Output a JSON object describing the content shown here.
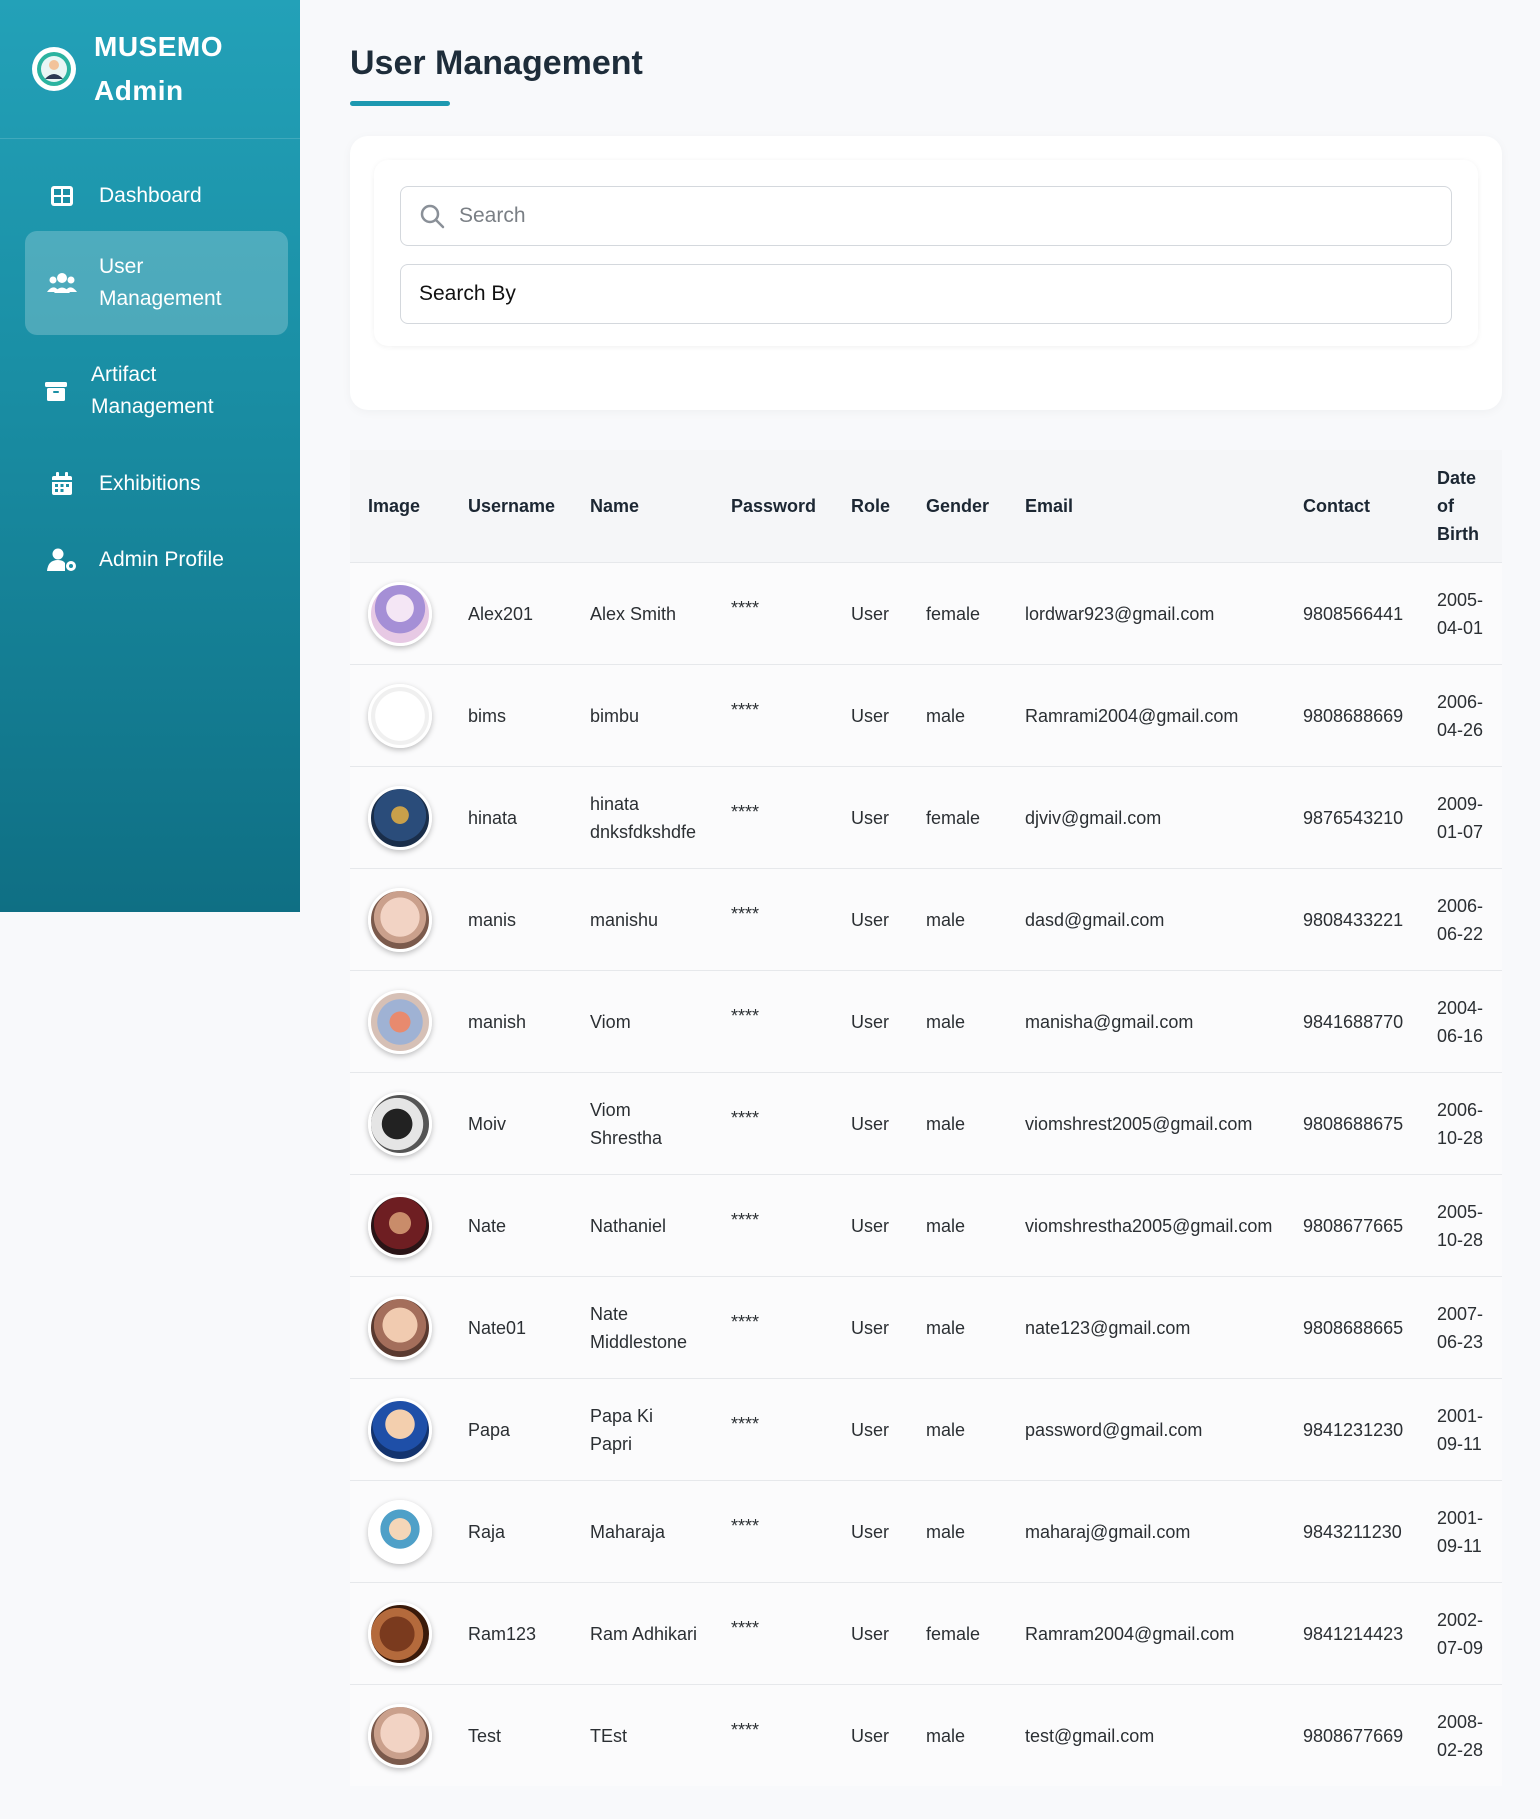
{
  "brand": {
    "line1": "MUSEMO",
    "line2": "Admin"
  },
  "nav": [
    {
      "label": "Dashboard",
      "icon": "dashboard-grid-icon"
    },
    {
      "label": "User Management",
      "icon": "users-icon",
      "active": true
    },
    {
      "label": "Artifact Management",
      "icon": "archive-box-icon"
    },
    {
      "label": "Exhibitions",
      "icon": "calendar-icon"
    },
    {
      "label": "Admin Profile",
      "icon": "user-gear-icon"
    }
  ],
  "page": {
    "title": "User Management"
  },
  "search": {
    "placeholder": "Search",
    "search_by": "Search By"
  },
  "table": {
    "headers": [
      "Image",
      "Username",
      "Name",
      "Password",
      "Role",
      "Gender",
      "Email",
      "Contact",
      "Date of Birth"
    ],
    "rows": [
      {
        "username": "Alex201",
        "name": "Alex Smith",
        "password": "****",
        "role": "User",
        "gender": "female",
        "email": "lordwar923@gmail.com",
        "contact": "9808566441",
        "dob": "2005-04-01"
      },
      {
        "username": "bims",
        "name": "bimbu",
        "password": "****",
        "role": "User",
        "gender": "male",
        "email": "Ramrami2004@gmail.com",
        "contact": "9808688669",
        "dob": "2006-04-26"
      },
      {
        "username": "hinata",
        "name": "hinata dnksfdkshdfe",
        "password": "****",
        "role": "User",
        "gender": "female",
        "email": "djviv@gmail.com",
        "contact": "9876543210",
        "dob": "2009-01-07"
      },
      {
        "username": "manis",
        "name": "manishu",
        "password": "****",
        "role": "User",
        "gender": "male",
        "email": "dasd@gmail.com",
        "contact": "9808433221",
        "dob": "2006-06-22"
      },
      {
        "username": "manish",
        "name": "Viom",
        "password": "****",
        "role": "User",
        "gender": "male",
        "email": "manisha@gmail.com",
        "contact": "9841688770",
        "dob": "2004-06-16"
      },
      {
        "username": "Moiv",
        "name": "Viom Shrestha",
        "password": "****",
        "role": "User",
        "gender": "male",
        "email": "viomshrest2005@gmail.com",
        "contact": "9808688675",
        "dob": "2006-10-28"
      },
      {
        "username": "Nate",
        "name": "Nathaniel",
        "password": "****",
        "role": "User",
        "gender": "male",
        "email": "viomshrestha2005@gmail.com",
        "contact": "9808677665",
        "dob": "2005-10-28"
      },
      {
        "username": "Nate01",
        "name": "Nate Middlestone",
        "password": "****",
        "role": "User",
        "gender": "male",
        "email": "nate123@gmail.com",
        "contact": "9808688665",
        "dob": "2007-06-23"
      },
      {
        "username": "Papa",
        "name": "Papa Ki Papri",
        "password": "****",
        "role": "User",
        "gender": "male",
        "email": "password@gmail.com",
        "contact": "9841231230",
        "dob": "2001-09-11"
      },
      {
        "username": "Raja",
        "name": "Maharaja",
        "password": "****",
        "role": "User",
        "gender": "male",
        "email": "maharaj@gmail.com",
        "contact": "9843211230",
        "dob": "2001-09-11"
      },
      {
        "username": "Ram123",
        "name": "Ram Adhikari",
        "password": "****",
        "role": "User",
        "gender": "female",
        "email": "Ramram2004@gmail.com",
        "contact": "9841214423",
        "dob": "2002-07-09"
      },
      {
        "username": "Test",
        "name": "TEst",
        "password": "****",
        "role": "User",
        "gender": "male",
        "email": "test@gmail.com",
        "contact": "9808677669",
        "dob": "2008-02-28"
      }
    ]
  },
  "colors": {
    "accent": "#1d99b1",
    "sidebar_top": "#23a1b8",
    "sidebar_bottom": "#0f6f84"
  }
}
